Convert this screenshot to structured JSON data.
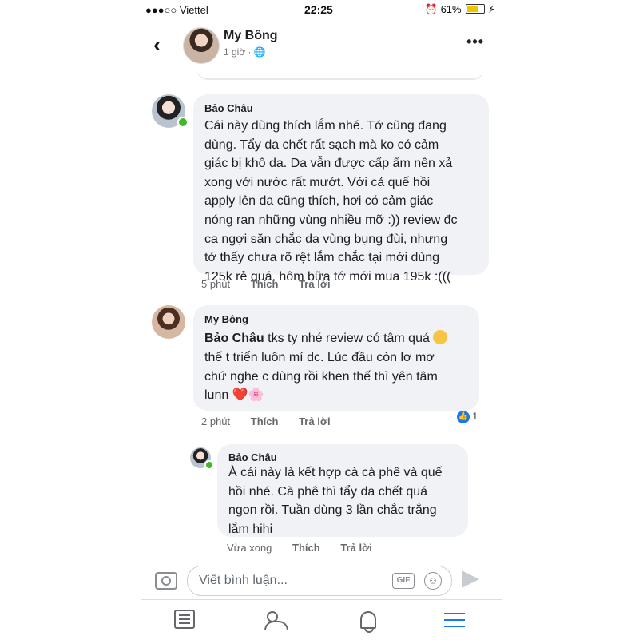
{
  "status_bar": {
    "carrier": "●●●○○ Viettel",
    "time": "22:25",
    "battery": "61%"
  },
  "header": {
    "name": "My Bông",
    "subtitle": "1 giờ · 🌐"
  },
  "comments": [
    {
      "author": "Bảo Châu",
      "text": "Cái này dùng thích lắm nhé. Tớ cũng đang\ndùng. Tẩy da chết rất sạch mà ko có cảm\ngiác bị khô da. Da vẫn được cấp ẩm nên xả\nxong với nước rất mướt. Với cả quế hồi\napply lên da cũng thích, hơi có cảm giác\nnóng ran những vùng nhiều mỡ :)) review đc\nca ngợi săn chắc da vùng bụng đùi, nhưng\ntớ thấy chưa rõ rệt lắm chắc tại mới dùng\n125k rẻ quá, hôm bữa tớ mới mua 195k :(((",
      "time": "5 phút",
      "like": "Thích",
      "reply": "Trả lời"
    },
    {
      "author": "My Bông",
      "mention": "Bảo Châu",
      "text_line1": " tks ty nhé review có tâm quá",
      "text_rest": "thế t triển luôn mí dc. Lúc đầu còn lơ mơ\nchứ nghe c dùng rồi khen thế thì yên tâm\nlunn",
      "heart": "❤️",
      "flower": "🌸",
      "time": "2 phút",
      "like": "Thích",
      "reply": "Trả lời",
      "like_count": "1"
    },
    {
      "author": "Bảo Châu",
      "text": "À cái này là kết hợp cà cà phê và quế\nhồi nhé. Cà phê thì tẩy da chết quá\nngon rồi. Tuần dùng 3 lần chắc trắng\nlắm hihi",
      "time": "Vừa xong",
      "like": "Thích",
      "reply": "Trả lời"
    }
  ],
  "composer": {
    "placeholder": "Viết bình luận...",
    "gif_label": "GIF"
  },
  "colors": {
    "bubble": "#f0f2f5",
    "accent": "#1877f2",
    "online": "#42b72a"
  }
}
